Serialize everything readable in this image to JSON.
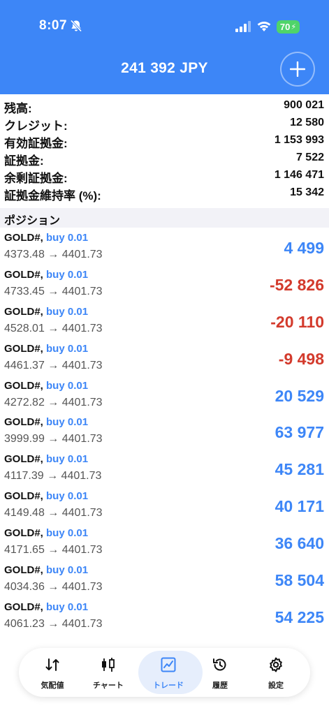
{
  "status_bar": {
    "time": "8:07",
    "battery": "70"
  },
  "header": {
    "balance_title": "241 392 JPY"
  },
  "summary": [
    {
      "label": "残高:",
      "value": "900 021"
    },
    {
      "label": "クレジット:",
      "value": "12 580"
    },
    {
      "label": "有効証拠金:",
      "value": "1 153 993"
    },
    {
      "label": "証拠金:",
      "value": "7 522"
    },
    {
      "label": "余剰証拠金:",
      "value": "1 146 471"
    },
    {
      "label": "証拠金維持率 (%):",
      "value": "15 342"
    }
  ],
  "positions_header": "ポジション",
  "positions": [
    {
      "symbol": "GOLD#,",
      "type": "buy 0.01",
      "prices": "4373.48 → 4401.73",
      "profit": "4 499",
      "sign": "pos"
    },
    {
      "symbol": "GOLD#,",
      "type": "buy 0.01",
      "prices": "4733.45 → 4401.73",
      "profit": "-52 826",
      "sign": "neg"
    },
    {
      "symbol": "GOLD#,",
      "type": "buy 0.01",
      "prices": "4528.01 → 4401.73",
      "profit": "-20 110",
      "sign": "neg"
    },
    {
      "symbol": "GOLD#,",
      "type": "buy 0.01",
      "prices": "4461.37 → 4401.73",
      "profit": "-9 498",
      "sign": "neg"
    },
    {
      "symbol": "GOLD#,",
      "type": "buy 0.01",
      "prices": "4272.82 → 4401.73",
      "profit": "20 529",
      "sign": "pos"
    },
    {
      "symbol": "GOLD#,",
      "type": "buy 0.01",
      "prices": "3999.99 → 4401.73",
      "profit": "63 977",
      "sign": "pos"
    },
    {
      "symbol": "GOLD#,",
      "type": "buy 0.01",
      "prices": "4117.39 → 4401.73",
      "profit": "45 281",
      "sign": "pos"
    },
    {
      "symbol": "GOLD#,",
      "type": "buy 0.01",
      "prices": "4149.48 → 4401.73",
      "profit": "40 171",
      "sign": "pos"
    },
    {
      "symbol": "GOLD#,",
      "type": "buy 0.01",
      "prices": "4171.65 → 4401.73",
      "profit": "36 640",
      "sign": "pos"
    },
    {
      "symbol": "GOLD#,",
      "type": "buy 0.01",
      "prices": "4034.36 → 4401.73",
      "profit": "58 504",
      "sign": "pos"
    },
    {
      "symbol": "GOLD#,",
      "type": "buy 0.01",
      "prices": "4061.23 → 4401.73",
      "profit": "54 225",
      "sign": "pos"
    }
  ],
  "tabs": [
    {
      "label": "気配値",
      "icon": "quotes-icon"
    },
    {
      "label": "チャート",
      "icon": "chart-candles-icon"
    },
    {
      "label": "トレード",
      "icon": "trade-icon",
      "active": true
    },
    {
      "label": "履歴",
      "icon": "history-icon"
    },
    {
      "label": "設定",
      "icon": "settings-icon"
    }
  ],
  "colors": {
    "accent": "#3d86f7",
    "negative": "#d33a2c",
    "battery": "#4fd46a"
  }
}
